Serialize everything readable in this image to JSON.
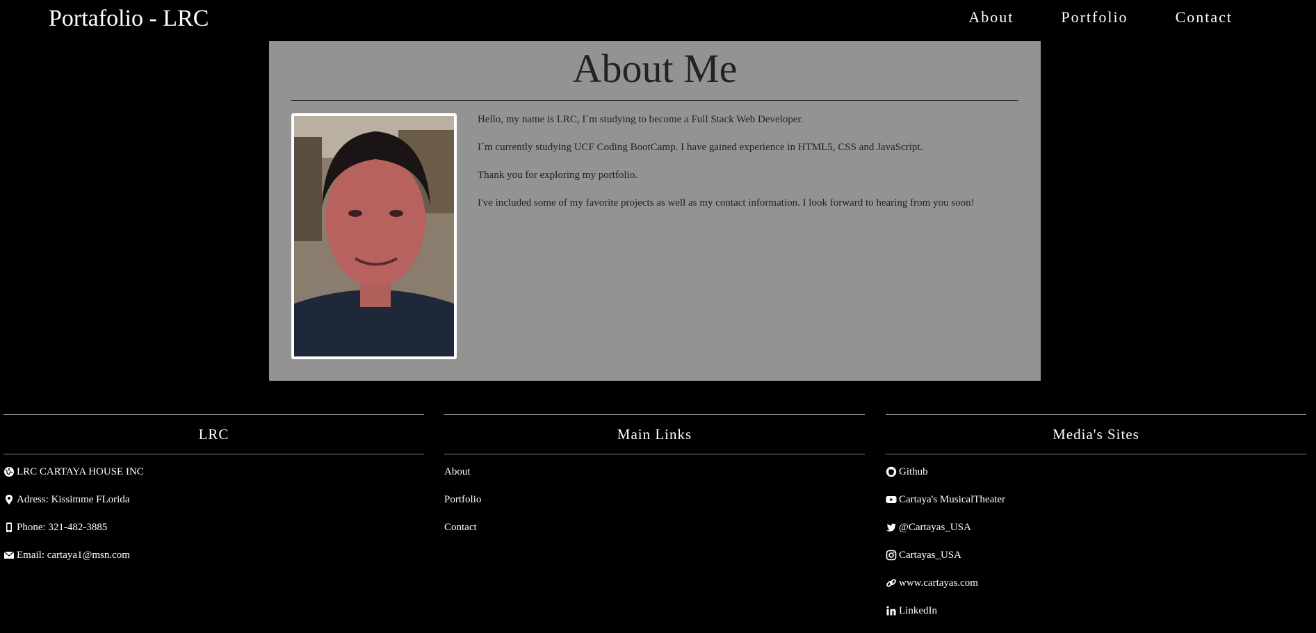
{
  "header": {
    "brand": "Portafolio - LRC",
    "nav": [
      {
        "label": "About"
      },
      {
        "label": "Portfolio"
      },
      {
        "label": "Contact"
      }
    ]
  },
  "about": {
    "title": "About Me",
    "paragraphs": [
      "Hello, my name is LRC, I´m studying to become a Full Stack Web Developer.",
      "I´m currently studying UCF Coding BootCamp. I have gained experience in HTML5, CSS and JavaScript.",
      "Thank you for exploring my portfolio.",
      "I've included some of my favorite projects as well as my contact information. I look forward to hearing from you soon!"
    ]
  },
  "footer": {
    "col1": {
      "title": "LRC",
      "items": [
        {
          "icon": "globe-icon",
          "text": "LRC CARTAYA HOUSE INC"
        },
        {
          "icon": "map-marker-icon",
          "text": "Adress: Kissimme FLorida"
        },
        {
          "icon": "mobile-phone-icon",
          "text": "Phone: 321-482-3885"
        },
        {
          "icon": "envelope-icon",
          "text": "Email: cartaya1@msn.com"
        }
      ]
    },
    "col2": {
      "title": "Main Links",
      "items": [
        {
          "text": "About"
        },
        {
          "text": "Portfolio"
        },
        {
          "text": "Contact"
        }
      ]
    },
    "col3": {
      "title": "Media's Sites",
      "items": [
        {
          "icon": "github-icon",
          "text": "Github"
        },
        {
          "icon": "youtube-icon",
          "text": "Cartaya's MusicalTheater"
        },
        {
          "icon": "twitter-icon",
          "text": "@Cartayas_USA"
        },
        {
          "icon": "instagram-icon",
          "text": "Cartayas_USA"
        },
        {
          "icon": "link-icon",
          "text": "www.cartayas.com"
        },
        {
          "icon": "linkedin-icon",
          "text": "LinkedIn"
        }
      ]
    }
  },
  "colors": {
    "background": "#000000",
    "about_panel": "#939393",
    "text_dark": "#222222",
    "text_light": "#ffffff"
  }
}
